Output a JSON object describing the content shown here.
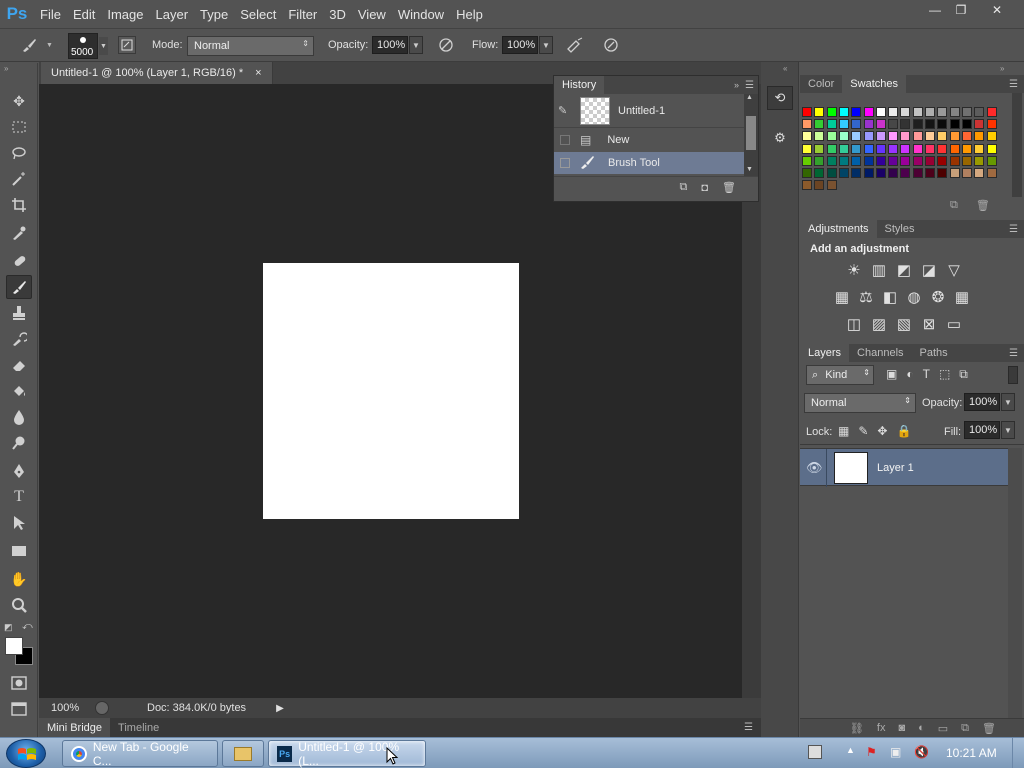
{
  "app": {
    "logo": "Ps",
    "menu": [
      "File",
      "Edit",
      "Image",
      "Layer",
      "Type",
      "Select",
      "Filter",
      "3D",
      "View",
      "Window",
      "Help"
    ],
    "window_controls": {
      "minimize": "—",
      "restore": "❐",
      "close": "✕"
    }
  },
  "options": {
    "brush_size": "5000",
    "mode_label": "Mode:",
    "mode_value": "Normal",
    "opacity_label": "Opacity:",
    "opacity_value": "100%",
    "flow_label": "Flow:",
    "flow_value": "100%"
  },
  "document": {
    "tab_title": "Untitled-1 @ 100% (Layer 1, RGB/16) *",
    "tab_close": "×",
    "zoom": "100%",
    "doc_info": "Doc: 384.0K/0 bytes",
    "bottom_tabs": [
      "Mini Bridge",
      "Timeline"
    ]
  },
  "history": {
    "tab": "History",
    "snapshot": "Untitled-1",
    "items": [
      "New",
      "Brush Tool"
    ]
  },
  "color_panel": {
    "tabs": [
      "Color",
      "Swatches"
    ],
    "swatch_rows": [
      [
        "#ff0000",
        "#ffff00",
        "#00ff00",
        "#00ffff",
        "#0000ff",
        "#ff00ff",
        "#ffffff",
        "#ebebeb",
        "#d6d6d6",
        "#c2c2c2",
        "#adadad",
        "#999999",
        "#858585",
        "#707070",
        "#5c5c5c",
        "#ff2a2a"
      ],
      [
        "#ff9966",
        "#33cc33",
        "#00cc99",
        "#33ccff",
        "#3366cc",
        "#9933cc",
        "#cc33cc",
        "#474747",
        "#333333",
        "#1f1f1f",
        "#141414",
        "#0a0a0a",
        "#000000",
        "#000000",
        "#cc3333",
        "#ff3300"
      ],
      [
        "#ffff99",
        "#ccff99",
        "#99ff99",
        "#99ffcc",
        "#99ccff",
        "#9999ff",
        "#cc99ff",
        "#ff99ff",
        "#ff99cc",
        "#ff9999",
        "#ffcc99",
        "#ffcc66",
        "#ff9933",
        "#ff6633",
        "#ff9900",
        "#ffcc00"
      ],
      [
        "#ffff33",
        "#99cc33",
        "#33cc66",
        "#33cc99",
        "#3399cc",
        "#3366ff",
        "#6633ff",
        "#9933ff",
        "#cc33ff",
        "#ff33cc",
        "#ff3366",
        "#ff3333",
        "#ff6600",
        "#ff9900",
        "#ffcc33",
        "#ffff00"
      ],
      [
        "#66cc00",
        "#33a02c",
        "#008060",
        "#007a80",
        "#005fa8",
        "#003399",
        "#330099",
        "#660099",
        "#990099",
        "#990066",
        "#990033",
        "#990000",
        "#993300",
        "#996600",
        "#999900",
        "#669900"
      ],
      [
        "#336600",
        "#006633",
        "#004d40",
        "#004466",
        "#002d66",
        "#001a66",
        "#1a0066",
        "#33004d",
        "#4d004d",
        "#4d0033",
        "#4d001a",
        "#4d0000",
        "#c8a07a",
        "#b08060",
        "#d4a880",
        "#a06a40"
      ],
      [
        "#8b5a2b",
        "#6b4423",
        "#7a5230"
      ]
    ]
  },
  "adjustments": {
    "tabs": [
      "Adjustments",
      "Styles"
    ],
    "heading": "Add an adjustment",
    "icons": [
      [
        "brightness-icon",
        "levels-icon",
        "curves-icon",
        "exposure-icon",
        "vibrance-icon"
      ],
      [
        "hue-saturation-icon",
        "color-balance-icon",
        "black-white-icon",
        "photo-filter-icon",
        "channel-mixer-icon",
        "color-lookup-icon"
      ],
      [
        "invert-icon",
        "posterize-icon",
        "threshold-icon",
        "selective-color-icon",
        "gradient-map-icon"
      ]
    ]
  },
  "layers": {
    "tabs": [
      "Layers",
      "Channels",
      "Paths"
    ],
    "filter_kind": "Kind",
    "blend_mode": "Normal",
    "opacity_label": "Opacity:",
    "opacity_value": "100%",
    "lock_label": "Lock:",
    "fill_label": "Fill:",
    "fill_value": "100%",
    "items": [
      {
        "name": "Layer 1",
        "visible": true
      }
    ]
  },
  "taskbar": {
    "chrome_task": "New Tab - Google C...",
    "ps_task": "Untitled-1 @ 100% (L...",
    "clock": "10:21 AM"
  }
}
